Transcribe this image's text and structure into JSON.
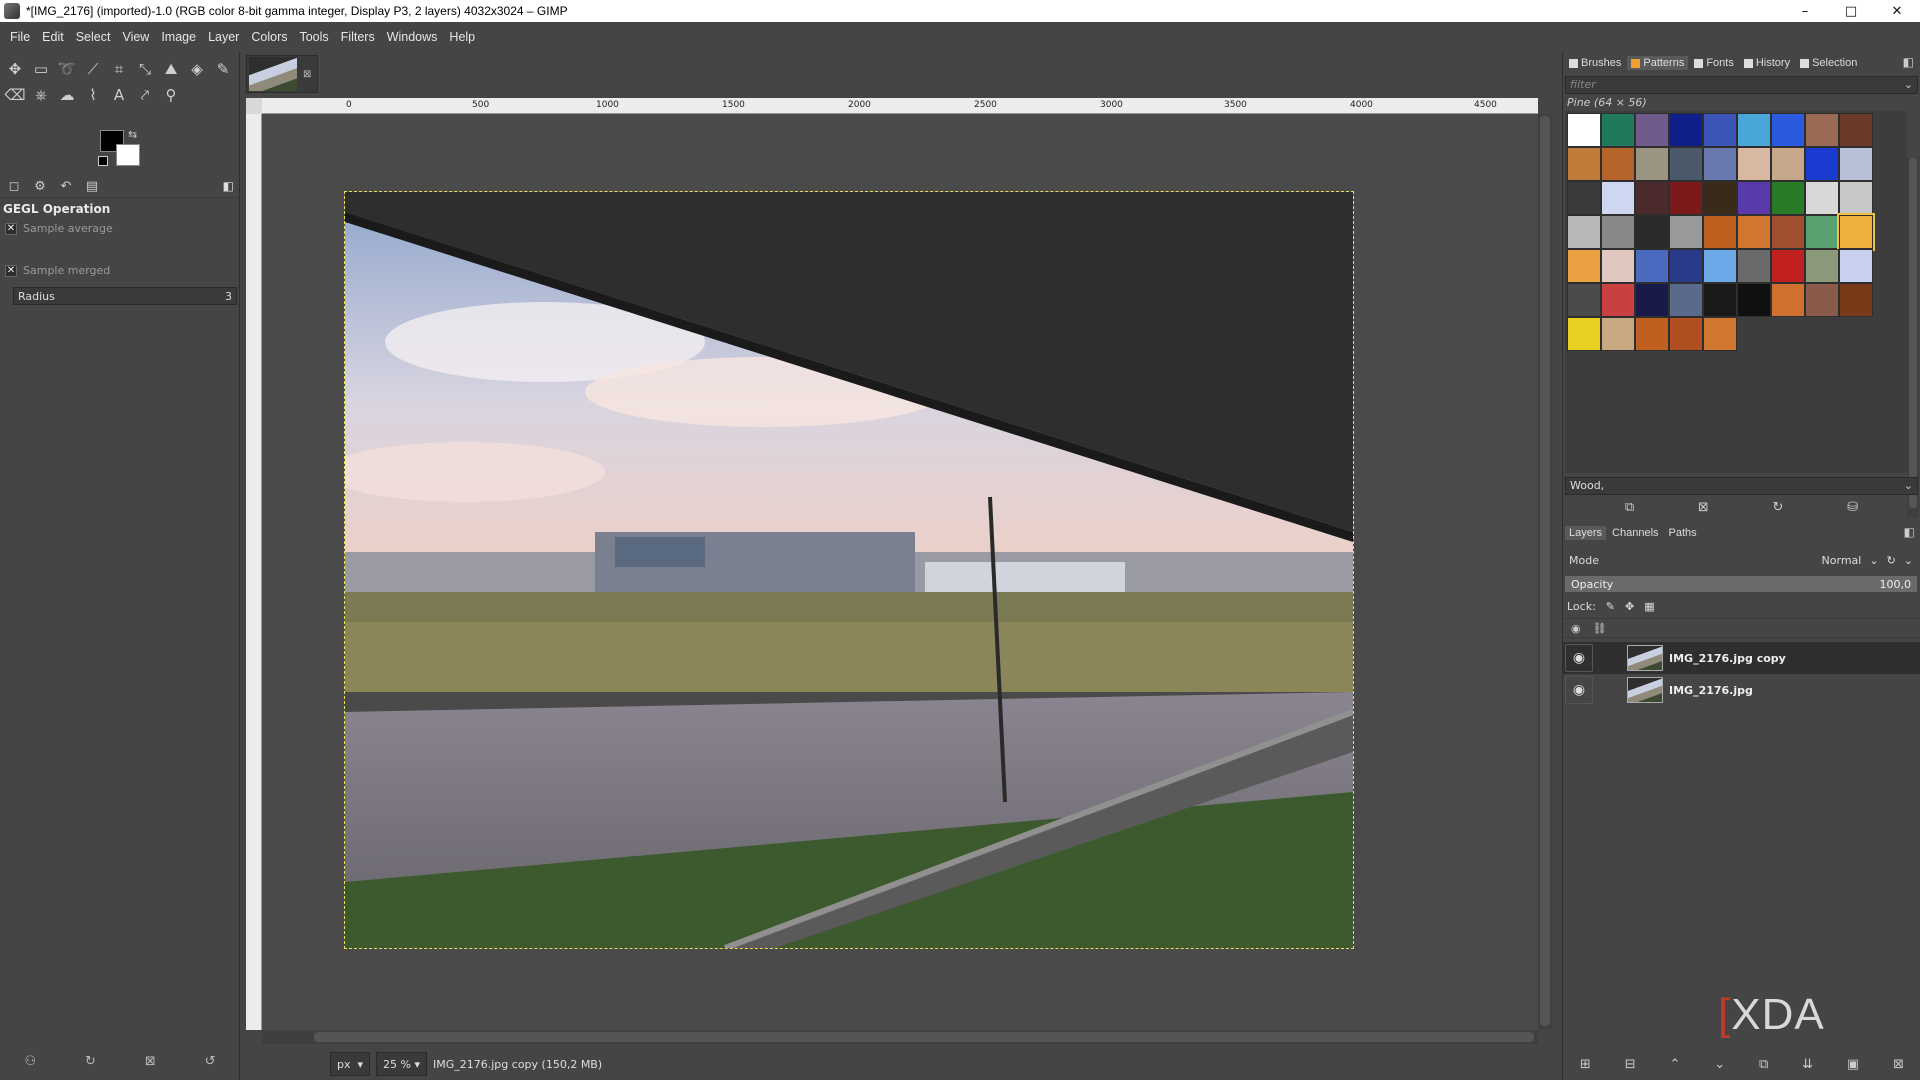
{
  "window": {
    "title": "*[IMG_2176] (imported)-1.0 (RGB color 8-bit gamma integer, Display P3, 2 layers) 4032x3024 – GIMP",
    "minimize": "–",
    "maximize": "□",
    "close": "✕"
  },
  "menu": [
    "File",
    "Edit",
    "Select",
    "View",
    "Image",
    "Layer",
    "Colors",
    "Tools",
    "Filters",
    "Windows",
    "Help"
  ],
  "tool_options": {
    "title": "GEGL Operation",
    "sample_average": "Sample average",
    "radius_label": "Radius",
    "radius_value": "3",
    "sample_merged": "Sample merged"
  },
  "ruler": {
    "h_labels": [
      "0",
      "500",
      "1000",
      "1500",
      "2000",
      "2500",
      "3000",
      "3500",
      "4000",
      "4500"
    ]
  },
  "status": {
    "unit": "px",
    "zoom": "25 %",
    "info": "IMG_2176.jpg copy (150,2 MB)"
  },
  "right_dock": {
    "tabs": [
      "Brushes",
      "Patterns",
      "Fonts",
      "History",
      "Selection"
    ],
    "filter_placeholder": "filter",
    "pattern_name": "Pine (64 × 56)",
    "tag_value": "Wood,",
    "layers_tabs": [
      "Layers",
      "Channels",
      "Paths"
    ],
    "mode_label": "Mode",
    "mode_value": "Normal",
    "opacity_label": "Opacity",
    "opacity_value": "100,0",
    "lock_label": "Lock:",
    "layers": [
      {
        "name": "IMG_2176.jpg copy",
        "selected": true
      },
      {
        "name": "IMG_2176.jpg",
        "selected": false
      }
    ]
  },
  "patterns": [
    "#ffffff",
    "#1f7a5c",
    "#6f5b8c",
    "#0f1f8a",
    "#3a54b8",
    "#4aa6d8",
    "#2a5ae0",
    "#9a6a55",
    "#6a3a2a",
    "#c07a3a",
    "#b5652a",
    "#9a9480",
    "#4a5a6a",
    "#6a7ab0",
    "#d8b8a0",
    "#c8a88a",
    "#1a3ad0",
    "#b8c0d8",
    "#3a3a3a",
    "#cdd8f0",
    "#4a2a2a",
    "#7a1a1a",
    "#3a2a1a",
    "#5a3aa8",
    "#2a7a2a",
    "#d8d8d8",
    "#c8c8c8",
    "#b8b8b8",
    "#888888",
    "#2a2a2a",
    "#9a9a9a",
    "#c06020",
    "#d07830",
    "#a05030",
    "#5aa070",
    "#f0b040",
    "#e8a040",
    "#e0c8c0",
    "#4a6ac0",
    "#2a3a8a",
    "#6aa8e8",
    "#6a6a6a",
    "#c02020",
    "#8a9a7a",
    "#c8d0f0",
    "#4a4a4a",
    "#c84040",
    "#1a1a4a",
    "#5a6a8a",
    "#1a1a1a",
    "#101010",
    "#d07030",
    "#8a5a4a",
    "#7a3a1a",
    "#e8d020",
    "#c8a880",
    "#c06020",
    "#b05020",
    "#d07830"
  ],
  "colors": {
    "accent_active_tab": "#f0a030",
    "selection_marching": "#e8e05a",
    "watermark_red": "#c0392b"
  },
  "watermark": {
    "left": "[",
    "text": "XDA"
  }
}
